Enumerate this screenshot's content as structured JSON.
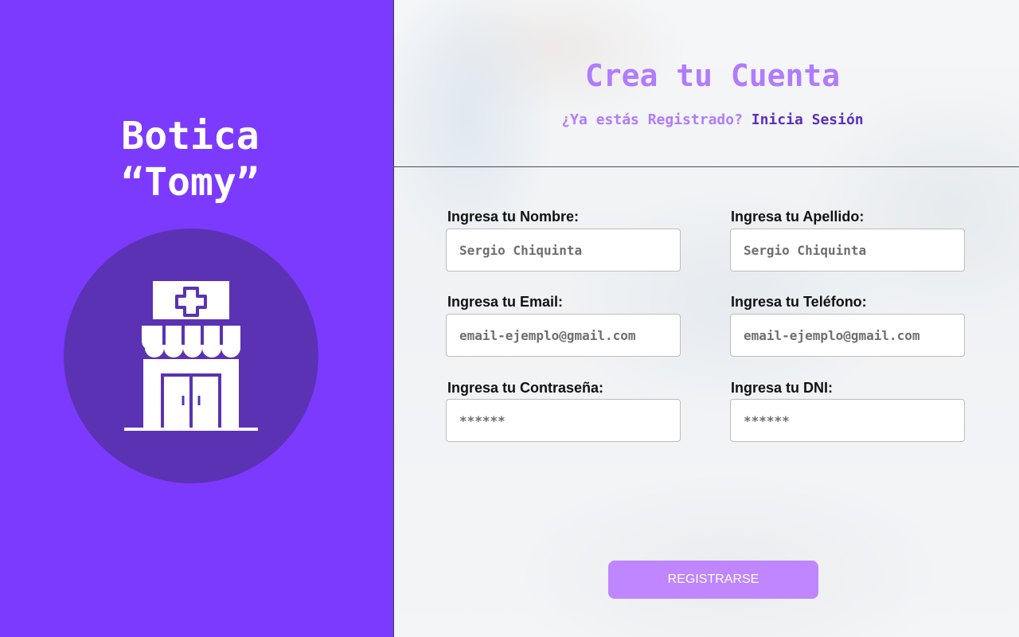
{
  "brand": {
    "line1": "Botica",
    "line2": "“Tomy”",
    "icon": "pharmacy-store-icon"
  },
  "header": {
    "title": "Crea tu Cuenta",
    "question": "¿Ya estás Registrado?",
    "login_link": "Inicia Sesión"
  },
  "form": {
    "nombre": {
      "label": "Ingresa tu Nombre:",
      "placeholder": "Sergio Chiquinta"
    },
    "apellido": {
      "label": "Ingresa tu Apellido:",
      "placeholder": "Sergio Chiquinta"
    },
    "email": {
      "label": "Ingresa tu Email:",
      "placeholder": "email-ejemplo@gmail.com"
    },
    "telefono": {
      "label": "Ingresa tu Teléfono:",
      "placeholder": "email-ejemplo@gmail.com"
    },
    "contrasena": {
      "label": "Ingresa tu Contraseña:",
      "placeholder": "******"
    },
    "dni": {
      "label": "Ingresa tu DNI:",
      "placeholder": "******"
    },
    "submit_label": "REGISTRARSE"
  },
  "colors": {
    "brand_purple": "#7c3aff",
    "circle_purple": "#5b32b3",
    "title_lavender": "#b17bff",
    "link_purple": "#5c2ec2",
    "button_lavender": "#bf86ff"
  }
}
